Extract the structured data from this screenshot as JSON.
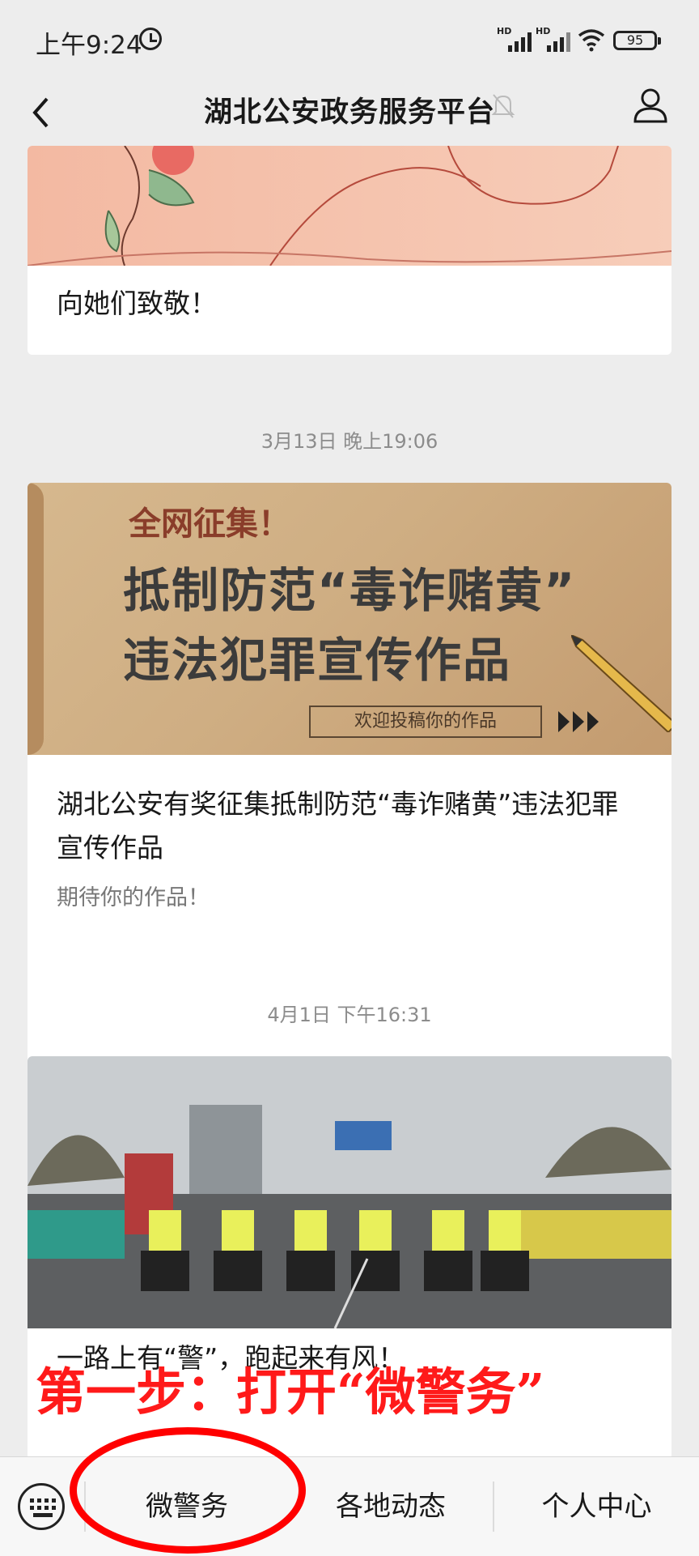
{
  "status": {
    "time": "上午9:24",
    "signal1": "HD",
    "signal2": "HD",
    "battery": "95"
  },
  "nav": {
    "title": "湖北公安政务服务平台"
  },
  "feed": {
    "card1": {
      "title": "向她们致敬！"
    },
    "time2": "3月13日 晚上19:06",
    "card2": {
      "banner_tag": "全网征集！",
      "banner_line1": "抵制防范“毒诈赌黄”",
      "banner_line2": "违法犯罪宣传作品",
      "banner_cta": "欢迎投稿你的作品",
      "title": "湖北公安有奖征集抵制防范“毒诈赌黄”违法犯罪宣传作品",
      "subtitle": "期待你的作品！"
    },
    "time3": "4月1日 下午16:31",
    "card3": {
      "title": "一路上有“警”，跑起来有风！"
    }
  },
  "bottom_menu": {
    "items": [
      "微警务",
      "各地动态",
      "个人中心"
    ]
  },
  "annotation": {
    "step": "第一步：打开“微警务”"
  },
  "colors": {
    "annotation_red": "#ff1a1a",
    "background": "#ededed"
  },
  "icons": [
    "back-icon",
    "mute-icon",
    "user-icon",
    "keyboard-icon",
    "alarm-icon",
    "wifi-icon",
    "battery-icon"
  ]
}
